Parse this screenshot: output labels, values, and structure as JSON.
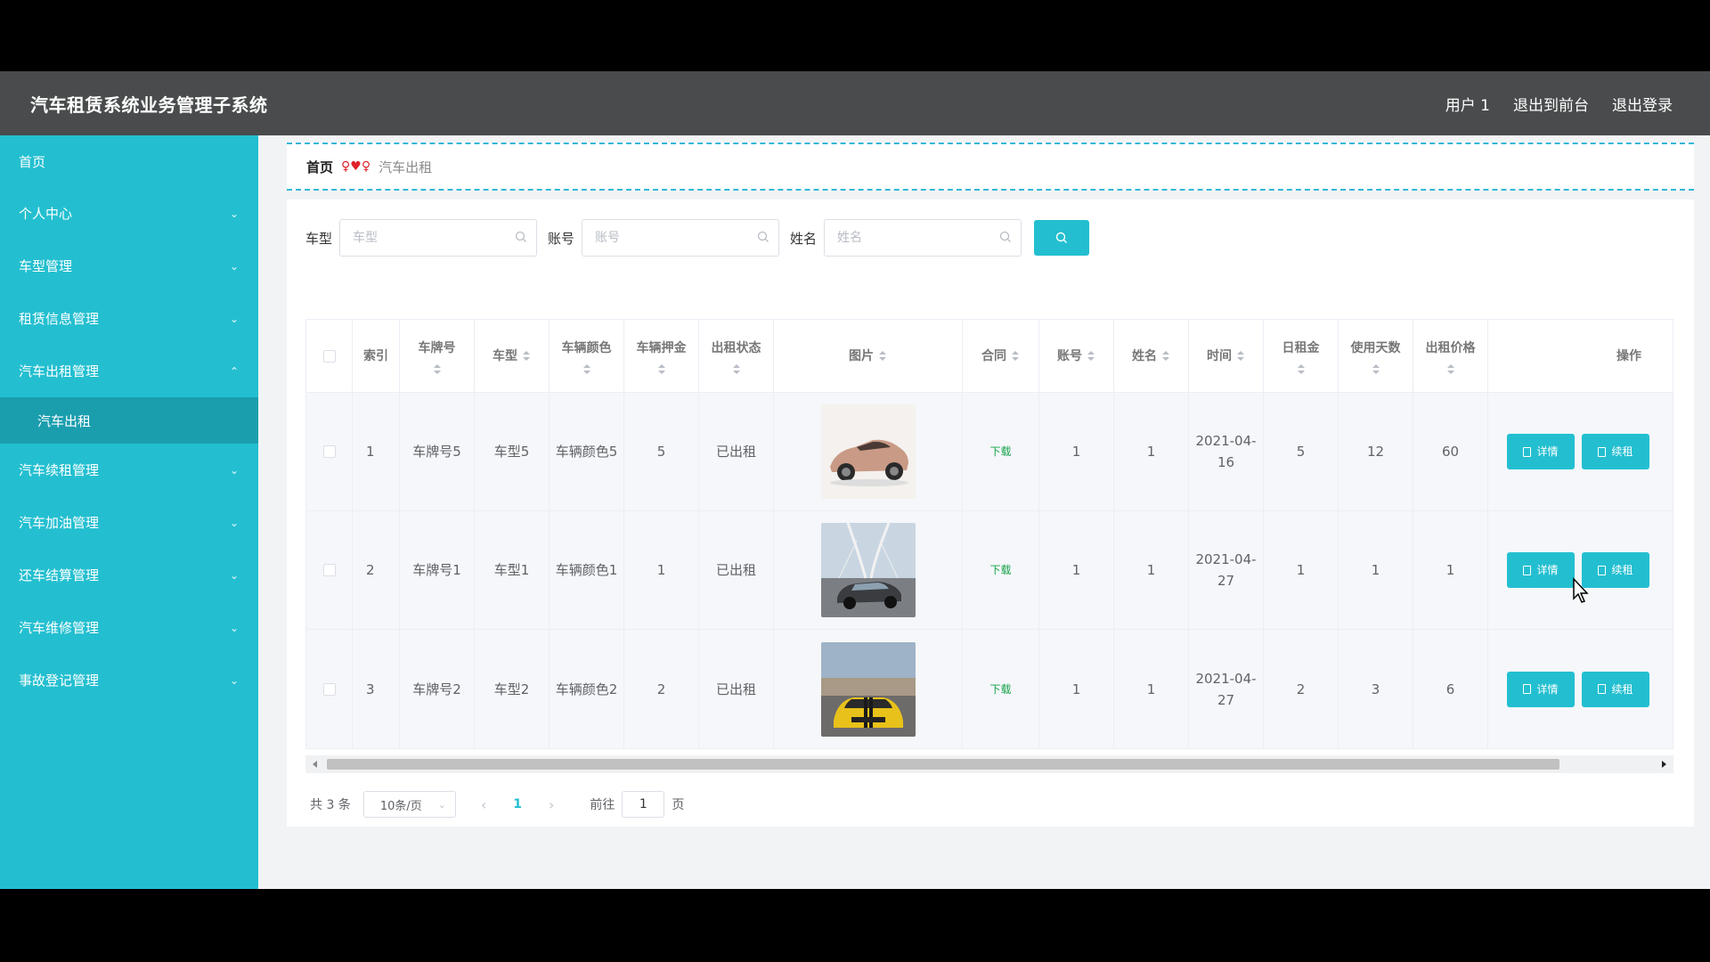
{
  "header": {
    "title": "汽车租赁系统业务管理子系统",
    "user": "用户 1",
    "exit_front": "退出到前台",
    "logout": "退出登录"
  },
  "sidebar": {
    "items": [
      {
        "label": "首页",
        "expandable": false
      },
      {
        "label": "个人中心",
        "expandable": true
      },
      {
        "label": "车型管理",
        "expandable": true
      },
      {
        "label": "租赁信息管理",
        "expandable": true
      },
      {
        "label": "汽车出租管理",
        "expandable": true,
        "expanded": true
      },
      {
        "label": "汽车续租管理",
        "expandable": true
      },
      {
        "label": "汽车加油管理",
        "expandable": true
      },
      {
        "label": "还车结算管理",
        "expandable": true
      },
      {
        "label": "汽车维修管理",
        "expandable": true
      },
      {
        "label": "事故登记管理",
        "expandable": true
      }
    ],
    "sub_active": "汽车出租"
  },
  "breadcrumb": {
    "home": "首页",
    "separator": "♥",
    "current": "汽车出租"
  },
  "search": {
    "model_label": "车型",
    "model_placeholder": "车型",
    "account_label": "账号",
    "account_placeholder": "账号",
    "name_label": "姓名",
    "name_placeholder": "姓名"
  },
  "table": {
    "headers": {
      "index": "索引",
      "plate": "车牌号",
      "model": "车型",
      "color": "车辆颜色",
      "deposit": "车辆押金",
      "status": "出租状态",
      "image": "图片",
      "contract": "合同",
      "account": "账号",
      "name": "姓名",
      "time": "时间",
      "daily": "日租金",
      "days": "使用天数",
      "price": "出租价格",
      "ops": "操作"
    },
    "rows": [
      {
        "index": "1",
        "plate": "车牌号5",
        "model": "车型5",
        "color": "车辆颜色5",
        "deposit": "5",
        "status": "已出租",
        "contract": "下载",
        "account": "1",
        "name": "1",
        "time": "2021-04-16",
        "daily": "5",
        "days": "12",
        "price": "60",
        "image": "rose-gold-coupe"
      },
      {
        "index": "2",
        "plate": "车牌号1",
        "model": "车型1",
        "color": "车辆颜色1",
        "deposit": "1",
        "status": "已出租",
        "contract": "下载",
        "account": "1",
        "name": "1",
        "time": "2021-04-27",
        "daily": "1",
        "days": "1",
        "price": "1",
        "image": "dark-sedan-bridge"
      },
      {
        "index": "3",
        "plate": "车牌号2",
        "model": "车型2",
        "color": "车辆颜色2",
        "deposit": "2",
        "status": "已出租",
        "contract": "下载",
        "account": "1",
        "name": "1",
        "time": "2021-04-27",
        "daily": "2",
        "days": "3",
        "price": "6",
        "image": "yellow-sports-car"
      }
    ],
    "detail_label": "详情",
    "renew_label": "续租"
  },
  "pagination": {
    "total": "共 3 条",
    "page_size": "10条/页",
    "current_page": "1",
    "goto_label": "前往",
    "goto_value": "1",
    "page_unit": "页"
  },
  "colors": {
    "accent": "#23bfd0",
    "header_bg": "#494b4c",
    "download": "#16a34a"
  }
}
